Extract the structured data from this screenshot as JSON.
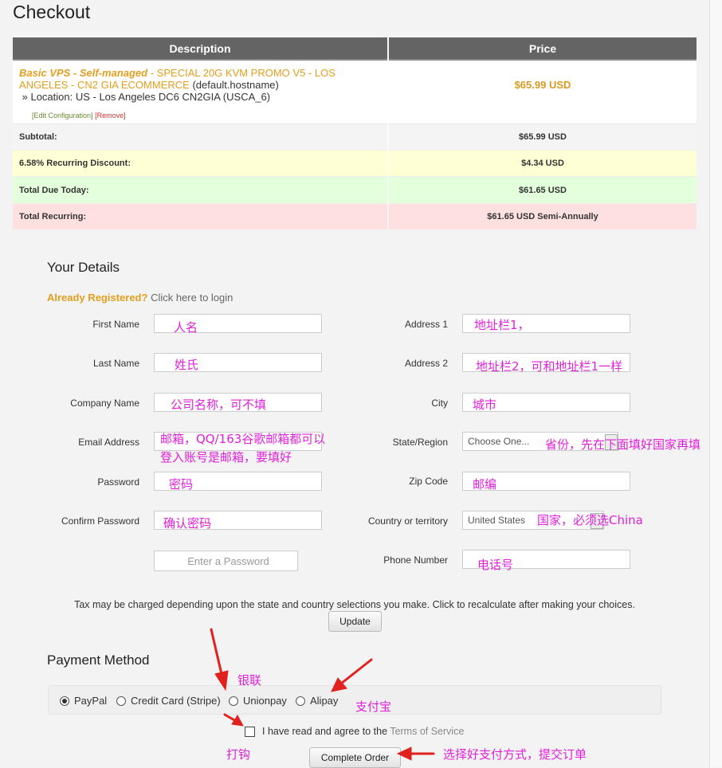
{
  "page": {
    "title": "Checkout"
  },
  "cart": {
    "headers": {
      "description": "Description",
      "price": "Price"
    },
    "item": {
      "name_italic": "Basic VPS - Self-managed",
      "name_rest": " - SPECIAL 20G KVM PROMO V5 - LOS ANGELES - CN2 GIA ECOMMERCE",
      "hostname": "(default.hostname)",
      "location": "» Location: US - Los Angeles DC6 CN2GIA (USCA_6)",
      "price": "$65.99 USD",
      "edit_link": "[Edit Configuration]",
      "remove_link": "[Remove]"
    },
    "subtotal": {
      "label": "Subtotal:",
      "value": "$65.99 USD"
    },
    "discount": {
      "label": "6.58% Recurring Discount:",
      "value": "$4.34 USD"
    },
    "due_today": {
      "label": "Total Due Today:",
      "value": "$61.65 USD"
    },
    "recurring": {
      "label": "Total Recurring:",
      "value": "$61.65 USD Semi-Annually"
    },
    "colors": {
      "header_bg": "#646464",
      "discount_bg": "#ffffd6",
      "due_bg": "#e4ffdb",
      "recurring_bg": "#ffe0e0"
    }
  },
  "details": {
    "title": "Your Details",
    "already_registered": "Already Registered?",
    "login_link": "Click here to login",
    "fields": {
      "first_name": {
        "label": "First Name",
        "note": "人名"
      },
      "last_name": {
        "label": "Last Name",
        "note": "姓氏"
      },
      "company": {
        "label": "Company Name",
        "note": "公司名称，可不填"
      },
      "email": {
        "label": "Email Address",
        "note_line1": "邮箱，QQ/163谷歌邮箱都可以",
        "note_line2": "登入账号是邮箱，要填好"
      },
      "password": {
        "label": "Password",
        "note": "密码"
      },
      "confirm_password": {
        "label": "Confirm Password",
        "note": "确认密码"
      },
      "password_strength": {
        "placeholder": "Enter a Password"
      },
      "address1": {
        "label": "Address 1",
        "note": "地址栏1，"
      },
      "address2": {
        "label": "Address 2",
        "note": "地址栏2，可和地址栏1一样"
      },
      "city": {
        "label": "City",
        "note": "城市"
      },
      "state": {
        "label": "State/Region",
        "value": "Choose One...",
        "note": "省份，先在下面填好国家再填"
      },
      "zip": {
        "label": "Zip Code",
        "note": "邮编"
      },
      "country": {
        "label": "Country or territory",
        "value": "United States",
        "note": "国家，必须选China"
      },
      "phone": {
        "label": "Phone Number",
        "note": "电话号"
      }
    },
    "tax_note": "Tax may be charged depending upon the state and country selections you make. Click to recalculate after making your choices.",
    "update_button": "Update"
  },
  "payment": {
    "title": "Payment Method",
    "options": [
      "PayPal",
      "Credit Card (Stripe)",
      "Unionpay",
      "Alipay"
    ],
    "selected": "PayPal",
    "tos_text": "I have read and agree to the",
    "tos_link": "Terms of Service",
    "complete_button": "Complete Order",
    "annotations": {
      "unionpay": "银联",
      "alipay": "支付宝",
      "checkbox": "打钩",
      "submit": "选择好支付方式，提交订单"
    },
    "annotation_color": "#e020d8",
    "arrow_color": "#e0211d"
  }
}
